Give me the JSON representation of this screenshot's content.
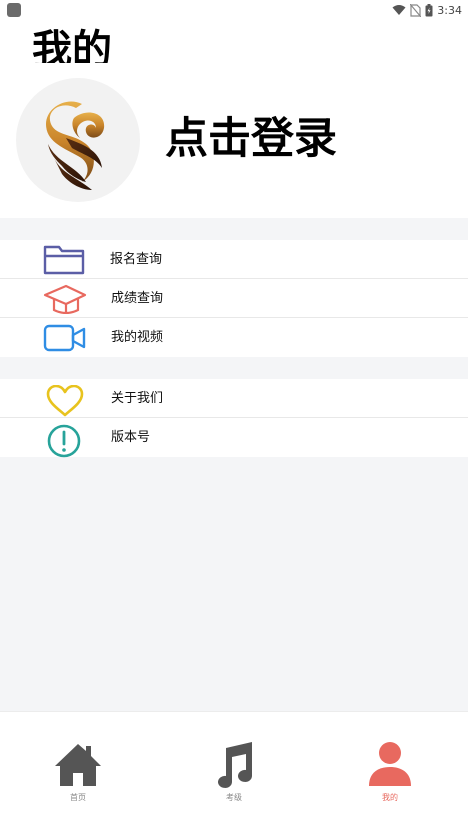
{
  "status_bar": {
    "time": "3:34"
  },
  "header": {
    "title": "我的"
  },
  "profile": {
    "login_label": "点击登录"
  },
  "menu_group_1": [
    {
      "label": "报名查询",
      "icon": "folder-icon",
      "color": "#5b5ea6"
    },
    {
      "label": "成绩查询",
      "icon": "graduation-cap-icon",
      "color": "#e8695f"
    },
    {
      "label": "我的视频",
      "icon": "video-camera-icon",
      "color": "#2f8de4"
    }
  ],
  "menu_group_2": [
    {
      "label": "关于我们",
      "icon": "heart-icon",
      "color": "#e8c31e"
    },
    {
      "label": "版本号",
      "icon": "info-alert-icon",
      "color": "#27a39a"
    }
  ],
  "tab_bar": {
    "tabs": [
      {
        "label": "首页",
        "icon": "home-icon"
      },
      {
        "label": "考级",
        "icon": "music-note-icon"
      },
      {
        "label": "我的",
        "icon": "user-icon",
        "active": true
      }
    ],
    "active_color": "#e8695f",
    "inactive_color": "#555555"
  }
}
